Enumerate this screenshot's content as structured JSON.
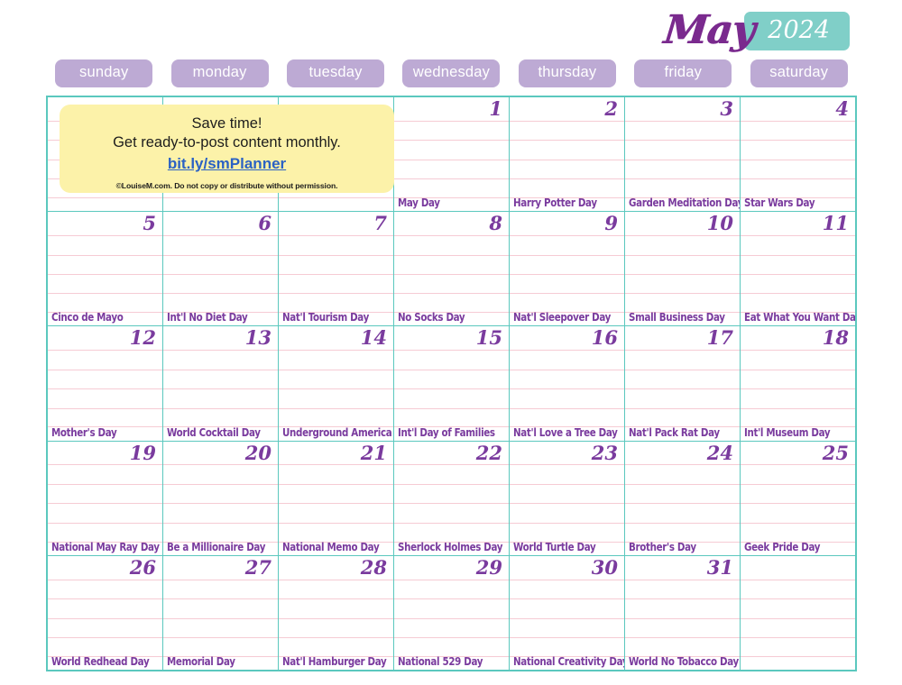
{
  "header": {
    "month": "May",
    "year": "2024",
    "month_color": "#7A2A8E",
    "year_badge_color": "#80CFC8"
  },
  "theme": {
    "grid_line_color": "#5BC8BE",
    "rule_line_color": "#F6CBD4",
    "day_pill_color": "#BDAAD4",
    "text_purple": "#7A3B9E",
    "promo_background": "#FCF2A9",
    "promo_link_color": "#2B62C4"
  },
  "weekdays": [
    {
      "label": "sunday"
    },
    {
      "label": "monday"
    },
    {
      "label": "tuesday"
    },
    {
      "label": "wednesday"
    },
    {
      "label": "thursday"
    },
    {
      "label": "friday"
    },
    {
      "label": "saturday"
    }
  ],
  "promo": {
    "line1": "Save time!",
    "line2": "Get ready-to-post content monthly.",
    "link": "bit.ly/smPlanner",
    "fine_print": "©LouiseM.com. Do not copy or distribute without permission."
  },
  "weeks": [
    [
      {
        "day": "",
        "label": ""
      },
      {
        "day": "",
        "label": ""
      },
      {
        "day": "",
        "label": ""
      },
      {
        "day": "1",
        "label": "May Day"
      },
      {
        "day": "2",
        "label": "Harry Potter Day"
      },
      {
        "day": "3",
        "label": "Garden Meditation Day"
      },
      {
        "day": "4",
        "label": "Star Wars Day"
      }
    ],
    [
      {
        "day": "5",
        "label": "Cinco de Mayo"
      },
      {
        "day": "6",
        "label": "Int'l No Diet Day"
      },
      {
        "day": "7",
        "label": "Nat'l Tourism Day"
      },
      {
        "day": "8",
        "label": "No Socks Day"
      },
      {
        "day": "9",
        "label": "Nat'l Sleepover Day"
      },
      {
        "day": "10",
        "label": "Small Business Day"
      },
      {
        "day": "11",
        "label": "Eat What You Want Day"
      }
    ],
    [
      {
        "day": "12",
        "label": "Mother's Day"
      },
      {
        "day": "13",
        "label": "World Cocktail Day"
      },
      {
        "day": "14",
        "label": "Underground America Day"
      },
      {
        "day": "15",
        "label": "Int'l Day of Families"
      },
      {
        "day": "16",
        "label": "Nat'l Love a Tree Day"
      },
      {
        "day": "17",
        "label": "Nat'l Pack Rat Day"
      },
      {
        "day": "18",
        "label": "Int'l Museum Day"
      }
    ],
    [
      {
        "day": "19",
        "label": "National May Ray Day"
      },
      {
        "day": "20",
        "label": "Be a Millionaire Day"
      },
      {
        "day": "21",
        "label": "National Memo Day"
      },
      {
        "day": "22",
        "label": "Sherlock Holmes Day"
      },
      {
        "day": "23",
        "label": "World Turtle Day"
      },
      {
        "day": "24",
        "label": "Brother's Day"
      },
      {
        "day": "25",
        "label": "Geek Pride Day"
      }
    ],
    [
      {
        "day": "26",
        "label": "World Redhead Day"
      },
      {
        "day": "27",
        "label": "Memorial Day"
      },
      {
        "day": "28",
        "label": "Nat'l Hamburger Day"
      },
      {
        "day": "29",
        "label": "National 529 Day"
      },
      {
        "day": "30",
        "label": "National Creativity Day"
      },
      {
        "day": "31",
        "label": "World No Tobacco Day"
      },
      {
        "day": "",
        "label": ""
      }
    ]
  ]
}
